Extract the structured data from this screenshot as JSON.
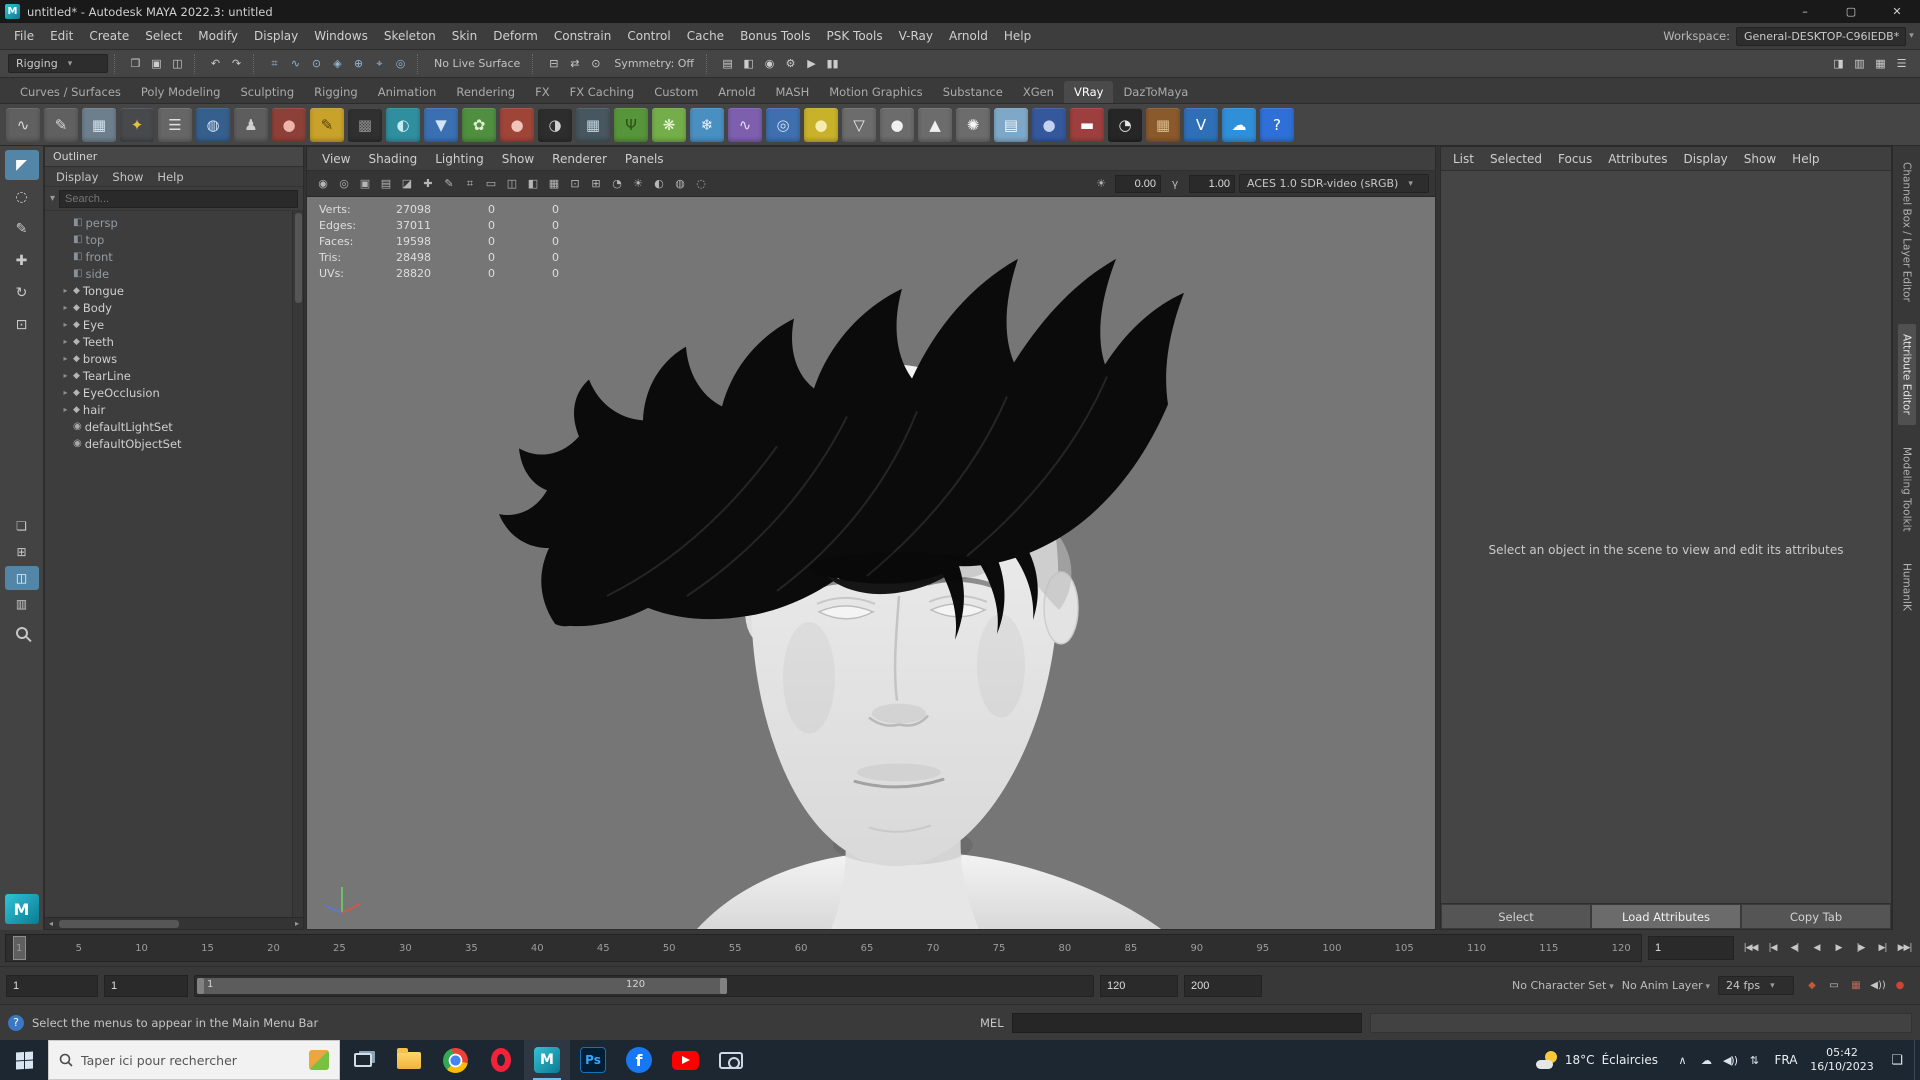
{
  "titlebar": {
    "title": "untitled* - Autodesk MAYA 2022.3: untitled",
    "app_badge_glyph": "M",
    "window_buttons": [
      {
        "name": "minimize-button",
        "glyph": "–"
      },
      {
        "name": "maximize-button",
        "glyph": "▢"
      },
      {
        "name": "close-button",
        "glyph": "✕"
      }
    ]
  },
  "menubar": {
    "items": [
      "File",
      "Edit",
      "Create",
      "Select",
      "Modify",
      "Display",
      "Windows",
      "Skeleton",
      "Skin",
      "Deform",
      "Constrain",
      "Control",
      "Cache",
      "Bonus Tools",
      "PSK Tools",
      "V-Ray",
      "Arnold",
      "Help"
    ],
    "workspace_label": "Workspace:",
    "workspace_value": "General-DESKTOP-C96IEDB*"
  },
  "statusline": {
    "menuset": "Rigging",
    "file_icons": [
      {
        "name": "new-scene-icon",
        "glyph": "❐"
      },
      {
        "name": "open-scene-icon",
        "glyph": "▣"
      },
      {
        "name": "save-scene-icon",
        "glyph": "◫"
      }
    ],
    "undo_icons": [
      {
        "name": "undo-icon",
        "glyph": "↶"
      },
      {
        "name": "redo-icon",
        "glyph": "↷"
      }
    ],
    "snap_icons": [
      {
        "name": "snap-to-grid-icon",
        "glyph": "⌗"
      },
      {
        "name": "snap-to-curve-icon",
        "glyph": "∿"
      },
      {
        "name": "snap-to-point-icon",
        "glyph": "⊙"
      },
      {
        "name": "snap-to-projected-center-icon",
        "glyph": "◈"
      },
      {
        "name": "make-live-icon",
        "glyph": "⊕"
      },
      {
        "name": "snap-to-view-plane-icon",
        "glyph": "⌖"
      },
      {
        "name": "snap-rotate-icon",
        "glyph": "◎"
      }
    ],
    "live_surface": "No Live Surface",
    "history_icons": [
      {
        "name": "input-operations-icon",
        "glyph": "⊟"
      },
      {
        "name": "construction-history-icon",
        "glyph": "⇄"
      },
      {
        "name": "selection-highlight-icon",
        "glyph": "⊙"
      }
    ],
    "symmetry": "Symmetry: Off",
    "render_icons": [
      {
        "name": "open-render-view-icon",
        "glyph": "▤"
      },
      {
        "name": "render-current-frame-icon",
        "glyph": "◧"
      },
      {
        "name": "ipr-render-icon",
        "glyph": "◉"
      },
      {
        "name": "render-settings-icon",
        "glyph": "⚙"
      },
      {
        "name": "playblast-icon",
        "glyph": "▶"
      },
      {
        "name": "pause-icon",
        "glyph": "▮▮"
      }
    ],
    "panel_toggle_icons": [
      {
        "name": "sidebar-attribute-editor-toggle-icon",
        "glyph": "◨"
      },
      {
        "name": "sidebar-tool-settings-toggle-icon",
        "glyph": "▥"
      },
      {
        "name": "sidebar-channel-box-toggle-icon",
        "glyph": "▦"
      },
      {
        "name": "sidebar-outliner-toggle-icon",
        "glyph": "☰"
      }
    ]
  },
  "shelf": {
    "tabs": [
      {
        "label": "Curves / Surfaces"
      },
      {
        "label": "Poly Modeling"
      },
      {
        "label": "Sculpting"
      },
      {
        "label": "Rigging"
      },
      {
        "label": "Animation"
      },
      {
        "label": "Rendering"
      },
      {
        "label": "FX"
      },
      {
        "label": "FX Caching"
      },
      {
        "label": "Custom"
      },
      {
        "label": "Arnold"
      },
      {
        "label": "MASH"
      },
      {
        "label": "Motion Graphics"
      },
      {
        "label": "Substance"
      },
      {
        "label": "XGen"
      },
      {
        "label": "VRay",
        "active": true
      },
      {
        "label": "DazToMaya"
      }
    ],
    "icons": [
      {
        "name": "cv-curve-tool-icon",
        "bg": "#606060",
        "fg": "#d8d8d8",
        "glyph": "∿"
      },
      {
        "name": "pencil-curve-tool-icon",
        "bg": "#606060",
        "fg": "#d8d8d8",
        "glyph": "✎"
      },
      {
        "name": "graph-editor-icon",
        "bg": "#6d7f8c",
        "fg": "#d4e4ee",
        "glyph": "▦"
      },
      {
        "name": "ik-handle-icon",
        "bg": "#47494c",
        "fg": "#e2c23c",
        "glyph": "✦"
      },
      {
        "name": "text-tool-icon",
        "bg": "#666666",
        "fg": "#e0e0e0",
        "glyph": "☰"
      },
      {
        "name": "ocean-sphere-icon",
        "bg": "#355f8d",
        "fg": "#cfe2f4",
        "glyph": "◍"
      },
      {
        "name": "crowd-tool-icon",
        "bg": "#5d5d5d",
        "fg": "#d0d0d0",
        "glyph": "♟"
      },
      {
        "name": "red-shader-ball-icon",
        "bg": "#8d4038",
        "fg": "#edb4aa",
        "glyph": "●"
      },
      {
        "name": "paint-effects-icon",
        "bg": "#c8a22a",
        "fg": "#544408",
        "glyph": "✎"
      },
      {
        "name": "texture-checker-icon",
        "bg": "#303030",
        "fg": "#8f8f8f",
        "glyph": "▩"
      },
      {
        "name": "toon-shader-icon",
        "bg": "#2f8f9e",
        "fg": "#c8ecf2",
        "glyph": "◐"
      },
      {
        "name": "fluid-drop-icon",
        "bg": "#3a6fb2",
        "fg": "#d2e6f8",
        "glyph": "▼"
      },
      {
        "name": "flower-brush-icon",
        "bg": "#4f8f3f",
        "fg": "#dff0d0",
        "glyph": "✿"
      },
      {
        "name": "apple-brush-icon",
        "bg": "#9e4538",
        "fg": "#f0c4bb",
        "glyph": "●"
      },
      {
        "name": "dark-sphere-icon",
        "bg": "#2d2d2d",
        "fg": "#cfcfcf",
        "glyph": "◑"
      },
      {
        "name": "checker-cube-icon",
        "bg": "#47565f",
        "fg": "#c2d4e0",
        "glyph": "▦"
      },
      {
        "name": "grass-brush-icon",
        "bg": "#57953a",
        "fg": "#2c5418",
        "glyph": "Ψ"
      },
      {
        "name": "foliage-brush-icon",
        "bg": "#74ae4a",
        "fg": "#ecf6dc",
        "glyph": "❋"
      },
      {
        "name": "ice-brush-icon",
        "bg": "#4a8fc2",
        "fg": "#e8f2fa",
        "glyph": "❄"
      },
      {
        "name": "noise-curve-icon",
        "bg": "#7d5fae",
        "fg": "#e6dcf6",
        "glyph": "∿"
      },
      {
        "name": "planet-icon",
        "bg": "#3f6fae",
        "fg": "#cfe0f6",
        "glyph": "◎"
      },
      {
        "name": "honey-shader-icon",
        "bg": "#c8b22a",
        "fg": "#f6ecb0",
        "glyph": "●"
      },
      {
        "name": "funnel-icon",
        "bg": "#6c6c6c",
        "fg": "#ececec",
        "glyph": "▽"
      },
      {
        "name": "white-sphere-icon",
        "bg": "#6c6c6c",
        "fg": "#f0f0f0",
        "glyph": "●"
      },
      {
        "name": "cone-icon",
        "bg": "#6c6c6c",
        "fg": "#f0f0f0",
        "glyph": "▲"
      },
      {
        "name": "light-burst-icon",
        "bg": "#6c6c6c",
        "fg": "#f6f6f6",
        "glyph": "✺"
      },
      {
        "name": "sky-gradient-icon",
        "bg": "#7fa8c8",
        "fg": "#f0f6fa",
        "glyph": "▤"
      },
      {
        "name": "glass-sphere-icon",
        "bg": "#35589d",
        "fg": "#c2d2f0",
        "glyph": "●"
      },
      {
        "name": "capsule-icon",
        "bg": "#9e3f3f",
        "fg": "#ffffff",
        "glyph": "▬"
      },
      {
        "name": "checker-ball-icon",
        "bg": "#262626",
        "fg": "#e8e8e8",
        "glyph": "◔"
      },
      {
        "name": "crate-icon",
        "bg": "#8a5a2c",
        "fg": "#dcba8c",
        "glyph": "▦"
      },
      {
        "name": "vray-shelf-icon",
        "bg": "#2f6fb8",
        "fg": "#ffffff",
        "glyph": "V"
      },
      {
        "name": "daz-bridge-icon",
        "bg": "#2f8fd8",
        "fg": "#ffffff",
        "glyph": "☁"
      },
      {
        "name": "help-shelf-icon",
        "bg": "#2f6fd8",
        "fg": "#ffffff",
        "glyph": "?"
      }
    ]
  },
  "toolbox": {
    "tools": [
      {
        "name": "select-tool",
        "glyph": "◤",
        "active": true
      },
      {
        "name": "lasso-tool",
        "glyph": "◌"
      },
      {
        "name": "paint-select-tool",
        "glyph": "✎"
      },
      {
        "name": "move-tool",
        "glyph": "✚"
      },
      {
        "name": "rotate-tool",
        "glyph": "↻"
      },
      {
        "name": "scale-tool",
        "glyph": "⊡"
      }
    ],
    "layouts": [
      {
        "name": "single-pane-layout-button",
        "glyph": "❏"
      },
      {
        "name": "four-pane-layout-button",
        "glyph": "⊞"
      },
      {
        "name": "pane-outliner-layout-button",
        "glyph": "◫",
        "active": true
      },
      {
        "name": "hypershade-layout-button",
        "glyph": "▥"
      }
    ],
    "maya_logo_glyph": "M"
  },
  "outliner": {
    "panel_title": "Outliner",
    "menus": [
      "Display",
      "Show",
      "Help"
    ],
    "search_placeholder": "Search...",
    "items": [
      {
        "label": "persp",
        "kind": "camera",
        "glyph": "◧",
        "arrow": ""
      },
      {
        "label": "top",
        "kind": "camera",
        "glyph": "◧",
        "arrow": ""
      },
      {
        "label": "front",
        "kind": "camera",
        "glyph": "◧",
        "arrow": ""
      },
      {
        "label": "side",
        "kind": "camera",
        "glyph": "◧",
        "arrow": ""
      },
      {
        "label": "Tongue",
        "kind": "mesh",
        "glyph": "◆",
        "arrow": "▸"
      },
      {
        "label": "Body",
        "kind": "mesh",
        "glyph": "◆",
        "arrow": "▸"
      },
      {
        "label": "Eye",
        "kind": "mesh",
        "glyph": "◆",
        "arrow": "▸"
      },
      {
        "label": "Teeth",
        "kind": "mesh",
        "glyph": "◆",
        "arrow": "▸"
      },
      {
        "label": "brows",
        "kind": "mesh",
        "glyph": "◆",
        "arrow": "▸"
      },
      {
        "label": "TearLine",
        "kind": "mesh",
        "glyph": "◆",
        "arrow": "▸"
      },
      {
        "label": "EyeOcclusion",
        "kind": "mesh",
        "glyph": "◆",
        "arrow": "▸"
      },
      {
        "label": "hair",
        "kind": "mesh",
        "glyph": "◆",
        "arrow": "▸"
      },
      {
        "label": "defaultLightSet",
        "kind": "set",
        "glyph": "◉",
        "arrow": ""
      },
      {
        "label": "defaultObjectSet",
        "kind": "set",
        "glyph": "◉",
        "arrow": ""
      }
    ]
  },
  "viewport": {
    "menus": [
      "View",
      "Shading",
      "Lighting",
      "Show",
      "Renderer",
      "Panels"
    ],
    "toolbar_icons": [
      {
        "name": "viewport-select-camera-icon",
        "glyph": "◉"
      },
      {
        "name": "viewport-lock-camera-icon",
        "glyph": "◎"
      },
      {
        "name": "viewport-camera-attributes-icon",
        "glyph": "▣"
      },
      {
        "name": "viewport-bookmarks-icon",
        "glyph": "▤"
      },
      {
        "name": "viewport-image-plane-icon",
        "glyph": "◪"
      },
      {
        "name": "viewport-2d-pan-zoom-icon",
        "glyph": "✚"
      },
      {
        "name": "viewport-grease-pencil-icon",
        "glyph": "✎"
      },
      {
        "name": "viewport-grid-icon",
        "glyph": "⌗"
      },
      {
        "name": "viewport-film-gate-icon",
        "glyph": "▭"
      },
      {
        "name": "viewport-resolution-gate-icon",
        "glyph": "◫"
      },
      {
        "name": "viewport-gate-mask-icon",
        "glyph": "◧"
      },
      {
        "name": "viewport-field-chart-icon",
        "glyph": "▦"
      },
      {
        "name": "viewport-safe-action-icon",
        "glyph": "⊡"
      },
      {
        "name": "viewport-safe-title-icon",
        "glyph": "⊞"
      },
      {
        "name": "viewport-frame-all-icon",
        "glyph": "◔"
      },
      {
        "name": "viewport-lighting-icon",
        "glyph": "☀"
      },
      {
        "name": "viewport-shadows-icon",
        "glyph": "◐"
      },
      {
        "name": "viewport-ambient-occlusion-icon",
        "glyph": "◍"
      },
      {
        "name": "viewport-motion-blur-icon",
        "glyph": "◌"
      }
    ],
    "exposure_icon_glyph": "☀",
    "exposure_value": "0.00",
    "gamma_icon_glyph": "γ",
    "gamma_value": "1.00",
    "view_transform": "ACES 1.0 SDR-video (sRGB)",
    "hud_rows": [
      {
        "label": "Verts:",
        "value": "27098",
        "sel": "0",
        "sel2": "0"
      },
      {
        "label": "Edges:",
        "value": "37011",
        "sel": "0",
        "sel2": "0"
      },
      {
        "label": "Faces:",
        "value": "19598",
        "sel": "0",
        "sel2": "0"
      },
      {
        "label": "Tris:",
        "value": "28498",
        "sel": "0",
        "sel2": "0"
      },
      {
        "label": "UVs:",
        "value": "28820",
        "sel": "0",
        "sel2": "0"
      }
    ]
  },
  "attribute_editor": {
    "menus": [
      "List",
      "Selected",
      "Focus",
      "Attributes",
      "Display",
      "Show",
      "Help"
    ],
    "empty_message": "Select an object in the scene to view and edit its attributes",
    "buttons": [
      {
        "label": "Select"
      },
      {
        "label": "Load Attributes",
        "active": true
      },
      {
        "label": "Copy Tab"
      }
    ]
  },
  "side_tabs": [
    {
      "label": "Channel Box / Layer Editor"
    },
    {
      "label": "Attribute Editor",
      "active": true
    },
    {
      "label": "Modeling Toolkit"
    },
    {
      "label": "HumanIK"
    }
  ],
  "timeline": {
    "ticks": [
      "1",
      "5",
      "10",
      "15",
      "20",
      "25",
      "30",
      "35",
      "40",
      "45",
      "50",
      "55",
      "60",
      "65",
      "70",
      "75",
      "80",
      "85",
      "90",
      "95",
      "100",
      "105",
      "110",
      "115",
      "120"
    ],
    "frame_field": "1",
    "playback_buttons": [
      {
        "name": "go-to-start-button",
        "glyph": "|◀◀"
      },
      {
        "name": "step-back-frame-button",
        "glyph": "|◀"
      },
      {
        "name": "step-back-key-button",
        "glyph": "◀|"
      },
      {
        "name": "play-backwards-button",
        "glyph": "◀"
      },
      {
        "name": "play-forwards-button",
        "glyph": "▶"
      },
      {
        "name": "step-forward-key-button",
        "glyph": "|▶"
      },
      {
        "name": "step-forward-frame-button",
        "glyph": "▶|"
      },
      {
        "name": "go-to-end-button",
        "glyph": "▶▶|"
      }
    ]
  },
  "range": {
    "anim_start": "1",
    "play_start": "1",
    "bar_start": "1",
    "bar_end": "120",
    "play_end": "120",
    "anim_end": "200",
    "character_set": "No Character Set",
    "anim_layer": "No Anim Layer",
    "fps": "24 fps",
    "right_icons": [
      {
        "name": "character-set-key-icon",
        "glyph": "◆",
        "color": "#c05a3a"
      },
      {
        "name": "script-feedback-icon",
        "glyph": "▭",
        "color": "#c6c6c6"
      },
      {
        "name": "command-builder-icon",
        "glyph": "▦",
        "color": "#b86a5a"
      },
      {
        "name": "mute-button",
        "glyph": "◀))",
        "color": "#c6c6c6"
      },
      {
        "name": "auto-keyframe-button",
        "glyph": "●",
        "color": "#cc4433"
      }
    ]
  },
  "command_line": {
    "help_icon_glyph": "?",
    "help_text": "Select the menus to appear in the Main Menu Bar",
    "mel_label": "MEL"
  },
  "taskbar": {
    "search_placeholder": "Taper ici pour rechercher",
    "apps": [
      {
        "name": "task-view-button",
        "kind": "taskview",
        "glyph": ""
      },
      {
        "name": "file-explorer-icon",
        "kind": "folder",
        "glyph": ""
      },
      {
        "name": "chrome-icon",
        "kind": "chrome",
        "glyph": ""
      },
      {
        "name": "opera-icon",
        "kind": "opera",
        "glyph": ""
      },
      {
        "name": "maya-taskbar-icon",
        "kind": "maya",
        "glyph": "M",
        "active": true
      },
      {
        "name": "photoshop-icon",
        "kind": "ps",
        "glyph": "Ps"
      },
      {
        "name": "facebook-icon",
        "kind": "fb",
        "glyph": "f"
      },
      {
        "name": "youtube-icon",
        "kind": "yt",
        "glyph": ""
      },
      {
        "name": "screenshot-tool-icon",
        "kind": "snip",
        "glyph": ""
      }
    ],
    "weather": {
      "temp": "18°C",
      "condition": "Éclaircies"
    },
    "tray_icons": [
      {
        "name": "tray-chevron-up-icon",
        "glyph": "∧"
      },
      {
        "name": "onedrive-icon",
        "glyph": "☁"
      },
      {
        "name": "volume-icon",
        "glyph": "◀))"
      },
      {
        "name": "network-icon",
        "glyph": "⇅"
      }
    ],
    "language": "FRA",
    "time": "05:42",
    "date": "16/10/2023",
    "action_center_glyph": "❏"
  }
}
